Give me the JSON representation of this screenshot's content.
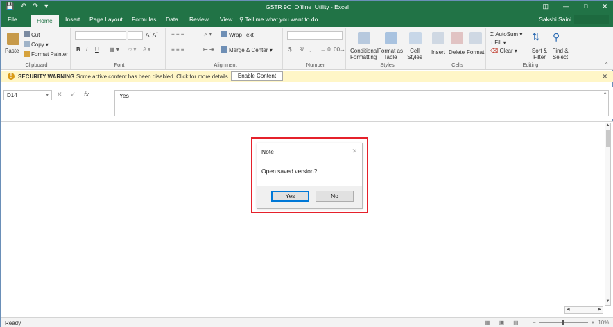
{
  "window": {
    "title": "GSTR 9C_Offline_Utility - Excel",
    "qat": [
      "save-icon",
      "undo-icon",
      "redo-icon",
      "customize-icon"
    ],
    "controls": [
      "ribbon-display-icon",
      "minimize-icon",
      "maximize-icon",
      "close-icon"
    ]
  },
  "tabs": [
    "File",
    "Home",
    "Insert",
    "Page Layout",
    "Formulas",
    "Data",
    "Review",
    "View"
  ],
  "active_tab": "Home",
  "tellme": "Tell me what you want to do...",
  "user": "Sakshi Saini",
  "ribbon": {
    "clipboard": {
      "label": "Clipboard",
      "paste": "Paste",
      "cut": "Cut",
      "copy": "Copy",
      "format_painter": "Format Painter"
    },
    "font": {
      "label": "Font",
      "font_name": "",
      "font_size": "",
      "bold": "B",
      "italic": "I",
      "underline": "U"
    },
    "alignment": {
      "label": "Alignment",
      "wrap_text": "Wrap Text",
      "merge_center": "Merge & Center"
    },
    "number": {
      "label": "Number",
      "format": "",
      "currency": "$",
      "percent": "%",
      "comma": ","
    },
    "styles": {
      "label": "Styles",
      "conditional": "Conditional Formatting",
      "format_table": "Format as Table",
      "cell_styles": "Cell Styles"
    },
    "cells": {
      "label": "Cells",
      "insert": "Insert",
      "delete": "Delete",
      "format": "Format"
    },
    "editing": {
      "label": "Editing",
      "autosum": "AutoSum",
      "fill": "Fill",
      "clear": "Clear",
      "sort_filter": "Sort & Filter",
      "find_select": "Find & Select"
    }
  },
  "security_bar": {
    "title": "SECURITY WARNING",
    "message": "Some active content has been disabled. Click for more details.",
    "button": "Enable Content"
  },
  "formula_bar": {
    "name_box": "D14",
    "fx": "fx",
    "value": "Yes"
  },
  "dialog": {
    "title": "Note",
    "message": "Open saved version?",
    "yes": "Yes",
    "no": "No"
  },
  "status": {
    "ready": "Ready",
    "zoom": "10%"
  },
  "colors": {
    "excel_green": "#217346",
    "warning_bg": "#fff6c7",
    "highlight": "#e5212b"
  }
}
